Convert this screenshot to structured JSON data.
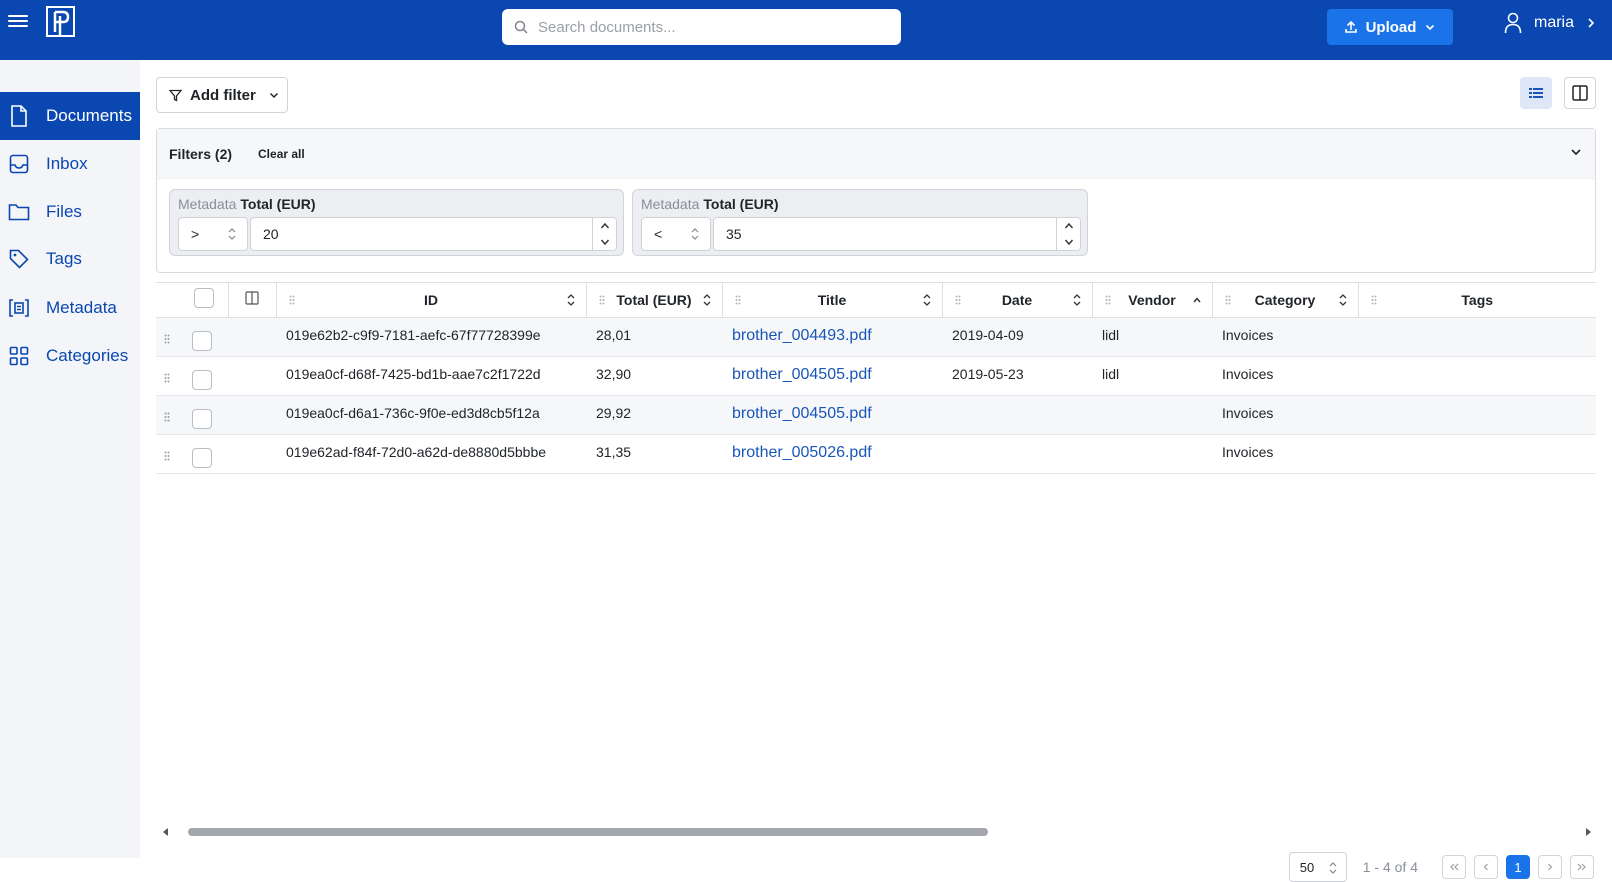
{
  "topbar": {
    "search_placeholder": "Search documents...",
    "upload_label": "Upload",
    "user_name": "maria",
    "brand_color": "#0b47b1"
  },
  "sidebar": {
    "items": [
      {
        "label": "Documents",
        "icon": "document-icon",
        "active": true
      },
      {
        "label": "Inbox",
        "icon": "inbox-icon"
      },
      {
        "label": "Files",
        "icon": "folder-icon"
      },
      {
        "label": "Tags",
        "icon": "tag-icon"
      },
      {
        "label": "Metadata",
        "icon": "metadata-icon"
      },
      {
        "label": "Categories",
        "icon": "grid-icon"
      }
    ]
  },
  "toolbar": {
    "add_filter_label": "Add filter"
  },
  "filters": {
    "title": "Filters (2)",
    "clear_all": "Clear all",
    "items": [
      {
        "prefix": "Metadata",
        "field": "Total (EUR)",
        "operator": ">",
        "value": "20"
      },
      {
        "prefix": "Metadata",
        "field": "Total (EUR)",
        "operator": "<",
        "value": "35"
      }
    ]
  },
  "table": {
    "columns": [
      "ID",
      "Total (EUR)",
      "Title",
      "Date",
      "Vendor",
      "Category",
      "Tags"
    ],
    "rows": [
      {
        "id": "019e62b2-c9f9-7181-aefc-67f77728399e",
        "total": "28,01",
        "title": "brother_004493.pdf",
        "date": "2019-04-09",
        "vendor": "lidl",
        "category": "Invoices",
        "tags": ""
      },
      {
        "id": "019ea0cf-d68f-7425-bd1b-aae7c2f1722d",
        "total": "32,90",
        "title": "brother_004505.pdf",
        "date": "2019-05-23",
        "vendor": "lidl",
        "category": "Invoices",
        "tags": ""
      },
      {
        "id": "019ea0cf-d6a1-736c-9f0e-ed3d8cb5f12a",
        "total": "29,92",
        "title": "brother_004505.pdf",
        "date": "",
        "vendor": "",
        "category": "Invoices",
        "tags": ""
      },
      {
        "id": "019e62ad-f84f-72d0-a62d-de8880d5bbbe",
        "total": "31,35",
        "title": "brother_005026.pdf",
        "date": "",
        "vendor": "",
        "category": "Invoices",
        "tags": ""
      }
    ]
  },
  "pagination": {
    "page_size": "50",
    "range": "1 - 4 of 4",
    "current_page": "1"
  }
}
